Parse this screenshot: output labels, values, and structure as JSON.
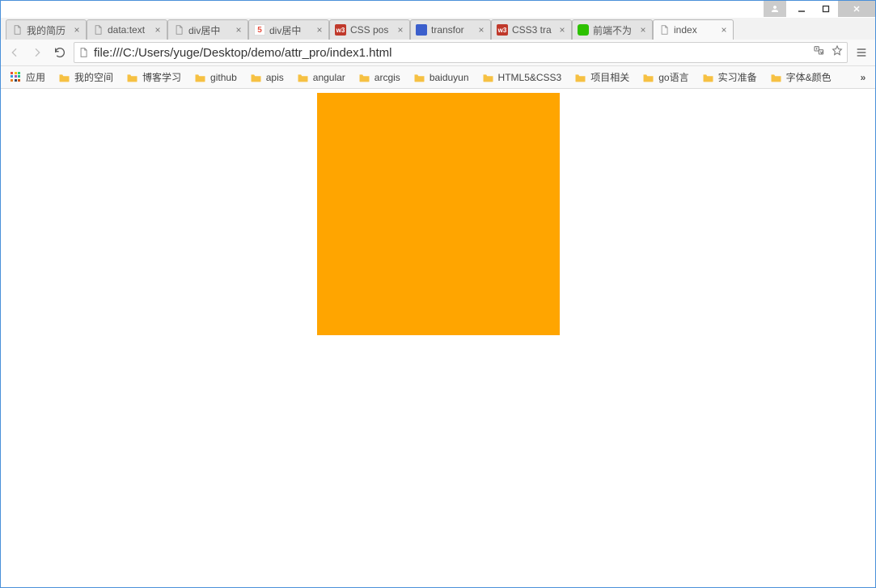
{
  "window_controls": {
    "minimize": "minimize",
    "maximize": "maximize",
    "close": "close",
    "user": "user"
  },
  "tabs": [
    {
      "title": "我的简历",
      "favicon": "page",
      "active": false
    },
    {
      "title": "data:text",
      "favicon": "page",
      "active": false
    },
    {
      "title": "div居中",
      "favicon": "page",
      "active": false
    },
    {
      "title": "div居中",
      "favicon": "five",
      "active": false
    },
    {
      "title": "CSS pos",
      "favicon": "w3",
      "active": false
    },
    {
      "title": "transfor",
      "favicon": "baidu",
      "active": false
    },
    {
      "title": "CSS3 tra",
      "favicon": "w3",
      "active": false
    },
    {
      "title": "前端不为",
      "favicon": "wechat",
      "active": false
    },
    {
      "title": "index",
      "favicon": "page",
      "active": true
    }
  ],
  "address_bar": {
    "url": "file:///C:/Users/yuge/Desktop/demo/attr_pro/index1.html",
    "translate_icon": "translate",
    "star_icon": "star"
  },
  "bookmarks_bar": {
    "apps_label": "应用",
    "items": [
      "我的空间",
      "博客学习",
      "github",
      "apis",
      "angular",
      "arcgis",
      "baiduyun",
      "HTML5&CSS3",
      "项目相关",
      "go语言",
      "实习准备",
      "字体&颜色"
    ],
    "overflow": "»"
  },
  "page_content": {
    "box_color": "#ffa500"
  }
}
